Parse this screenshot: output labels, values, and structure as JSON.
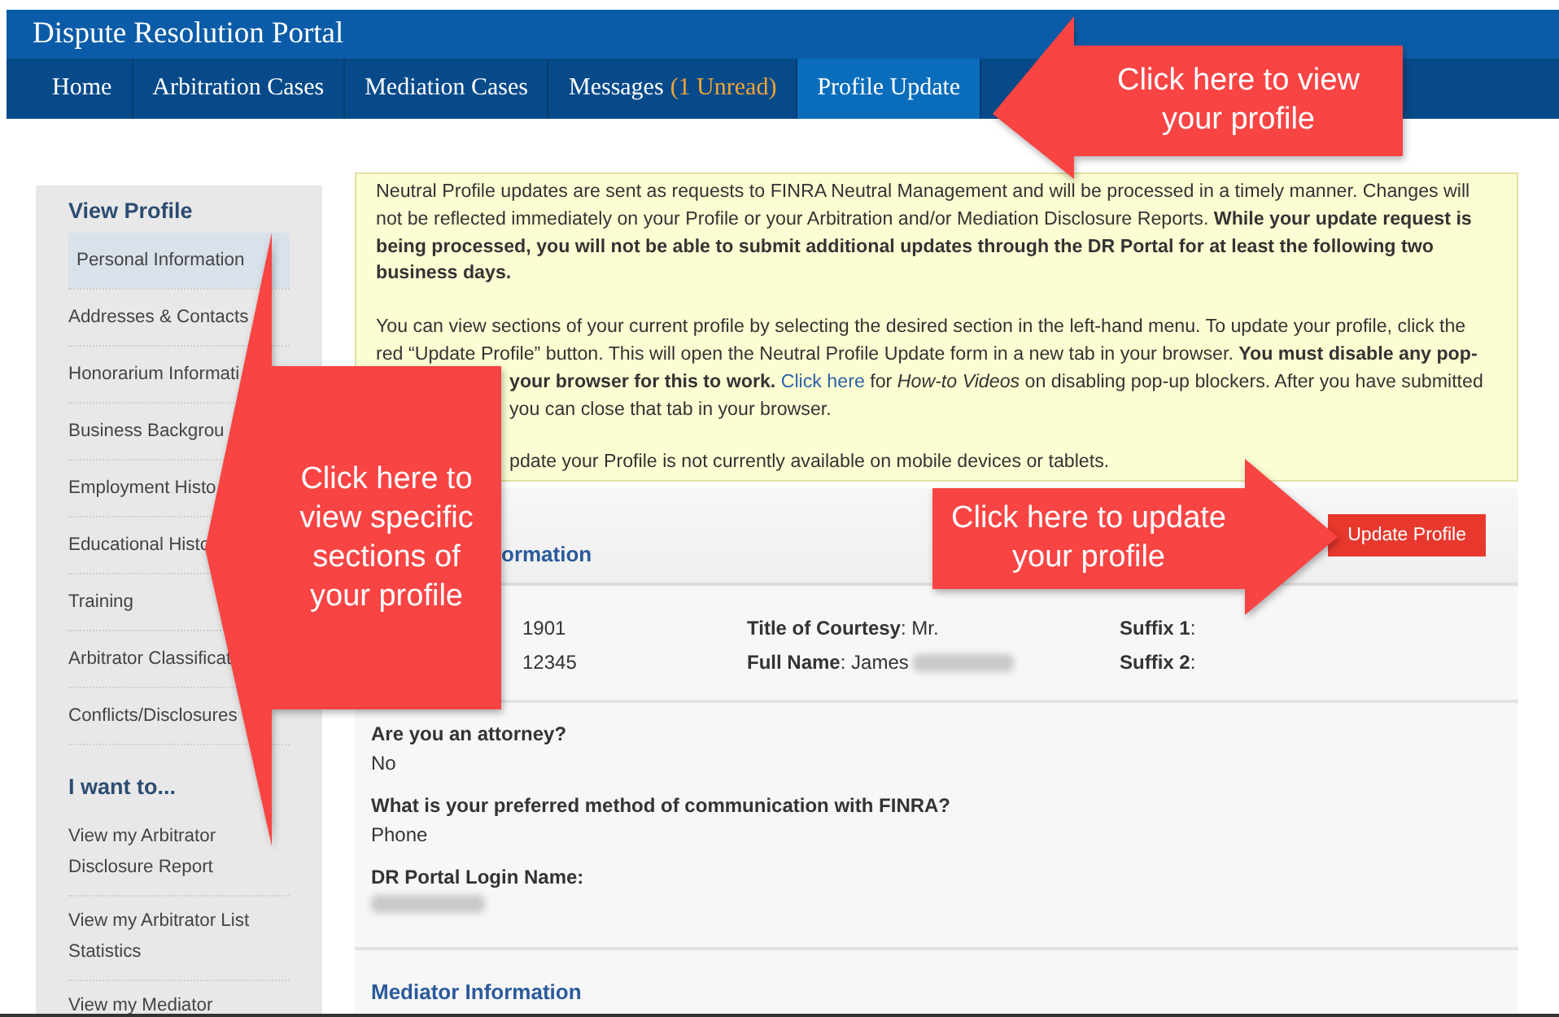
{
  "header": {
    "title": "Dispute Resolution Portal"
  },
  "nav": [
    {
      "label": "Home",
      "selected": false
    },
    {
      "label": "Arbitration Cases",
      "selected": false
    },
    {
      "label": "Mediation Cases",
      "selected": false
    },
    {
      "label": "Messages",
      "badge": "(1 Unread)",
      "selected": false
    },
    {
      "label": "Profile Update",
      "selected": true
    }
  ],
  "sidebar": {
    "sections": [
      {
        "heading": "View Profile",
        "items": [
          {
            "label": "Personal Information",
            "selected": true
          },
          {
            "label": "Addresses & Contacts",
            "selected": false
          },
          {
            "label": "Honorarium Informati",
            "selected": false
          },
          {
            "label": "Business Backgrou",
            "selected": false
          },
          {
            "label": "Employment Histo",
            "selected": false
          },
          {
            "label": "Educational Histo",
            "selected": false
          },
          {
            "label": "Training",
            "selected": false
          },
          {
            "label": "Arbitrator Classificat",
            "selected": false
          },
          {
            "label": "Conflicts/Disclosures",
            "selected": false
          }
        ]
      },
      {
        "heading": "I want to...",
        "items": [
          {
            "label": "View my Arbitrator Disclosure Report",
            "selected": false
          },
          {
            "label": "View my Arbitrator List Statistics",
            "selected": false
          },
          {
            "label": "View my Mediator",
            "selected": false
          }
        ]
      }
    ]
  },
  "notice": {
    "lines": [
      {
        "kind": "full",
        "parts": [
          {
            "kind": "plain",
            "text": "Neutral Profile updates are sent as requests to FINRA Neutral Management and will be processed in a timely manner. Changes will"
          }
        ]
      },
      {
        "kind": "full",
        "parts": [
          {
            "kind": "plain",
            "text": "not be reflected immediately on your Profile or your Arbitration and/or Mediation Disclosure Reports. "
          },
          {
            "kind": "bold",
            "text": "While your update request is"
          }
        ]
      },
      {
        "kind": "full",
        "parts": [
          {
            "kind": "bold",
            "text": "being processed, you will not be able to submit additional updates through the DR Portal for at least the following two"
          }
        ]
      },
      {
        "kind": "full",
        "parts": [
          {
            "kind": "bold",
            "text": "business days."
          }
        ]
      },
      {
        "kind": "full_after_gap",
        "parts": [
          {
            "kind": "plain",
            "text": "You can view sections of your current profile by selecting the desired section in the left-hand menu. To update your profile, click the"
          }
        ]
      },
      {
        "kind": "full",
        "parts": [
          {
            "kind": "plain",
            "text": "red “Update Profile” button. This will open the Neutral Profile Update form in a new tab in your browser. "
          },
          {
            "kind": "bold",
            "text": "You must disable any pop-"
          }
        ]
      },
      {
        "kind": "behind_callout",
        "parts": [
          {
            "kind": "bold",
            "text": "your browser for this to work. "
          },
          {
            "kind": "link",
            "text": "Click here"
          },
          {
            "kind": "plain",
            "text": " for "
          },
          {
            "kind": "italic",
            "text": "How-to Videos"
          },
          {
            "kind": "plain",
            "text": " on disabling pop-up blockers. After you have submitted"
          }
        ]
      },
      {
        "kind": "behind_callout",
        "parts": [
          {
            "kind": "plain",
            "text": "you can close that tab in your browser."
          }
        ]
      },
      {
        "kind": "behind_callout_after_gap",
        "parts": [
          {
            "kind": "plain",
            "text": "pdate your Profile is not currently available on mobile devices or tablets."
          }
        ]
      }
    ]
  },
  "profile": {
    "section_title": "ormation",
    "update_button": "Update Profile",
    "rows": [
      [
        {
          "text": "1901",
          "redacted": false
        },
        {
          "text": "**Title of Courtesy**: Mr.",
          "redacted": false
        },
        {
          "text": "**Suffix 1**:",
          "redacted": false
        }
      ],
      [
        {
          "text": "12345",
          "redacted": false
        },
        {
          "text": "**Full Name**: James",
          "redacted": true
        },
        {
          "text": "**Suffix 2**:",
          "redacted": false
        }
      ]
    ],
    "questions": [
      {
        "question": "Are you an attorney?",
        "answer": "No",
        "redacted": false
      },
      {
        "question": "What is your preferred method of communication with FINRA?",
        "answer": "Phone",
        "redacted": false
      },
      {
        "question": "DR Portal Login Name:",
        "redacted": true
      }
    ],
    "next_section": "Mediator Information"
  },
  "callouts": [
    {
      "text": "Click here to view your profile"
    },
    {
      "text": "Click here to view specific sections of your profile"
    },
    {
      "text": "Click here to update your profile"
    }
  ]
}
